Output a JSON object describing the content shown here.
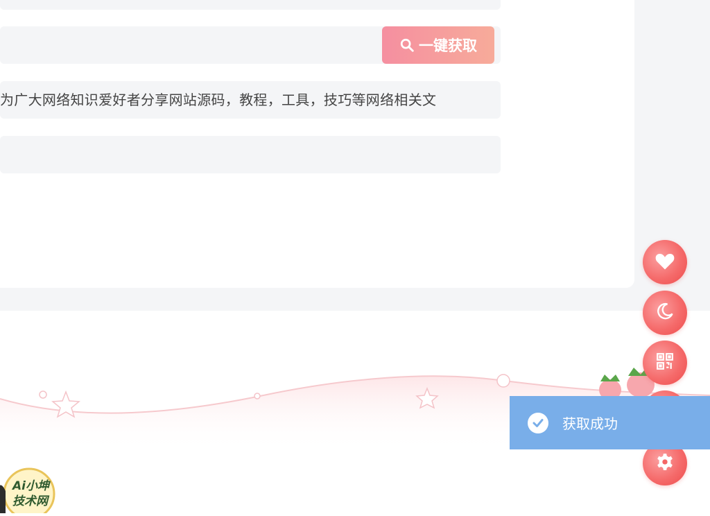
{
  "form": {
    "fetch_button_label": "一键获取",
    "description_value": "为广大网络知识爱好者分享网站源码，教程，工具，技巧等网络相关文"
  },
  "toast": {
    "message": "获取成功"
  },
  "side_buttons": [
    "heart-icon",
    "moon-icon",
    "qrcode-icon",
    "up-icon",
    "gear-icon"
  ],
  "logo": {
    "line1": "Ai小坤",
    "line2": "技术网"
  },
  "colors": {
    "accent_pink": "#f58fa0",
    "side_red": "#f56b6b",
    "toast_blue": "#79aee9",
    "field_bg": "#f4f5f7"
  }
}
